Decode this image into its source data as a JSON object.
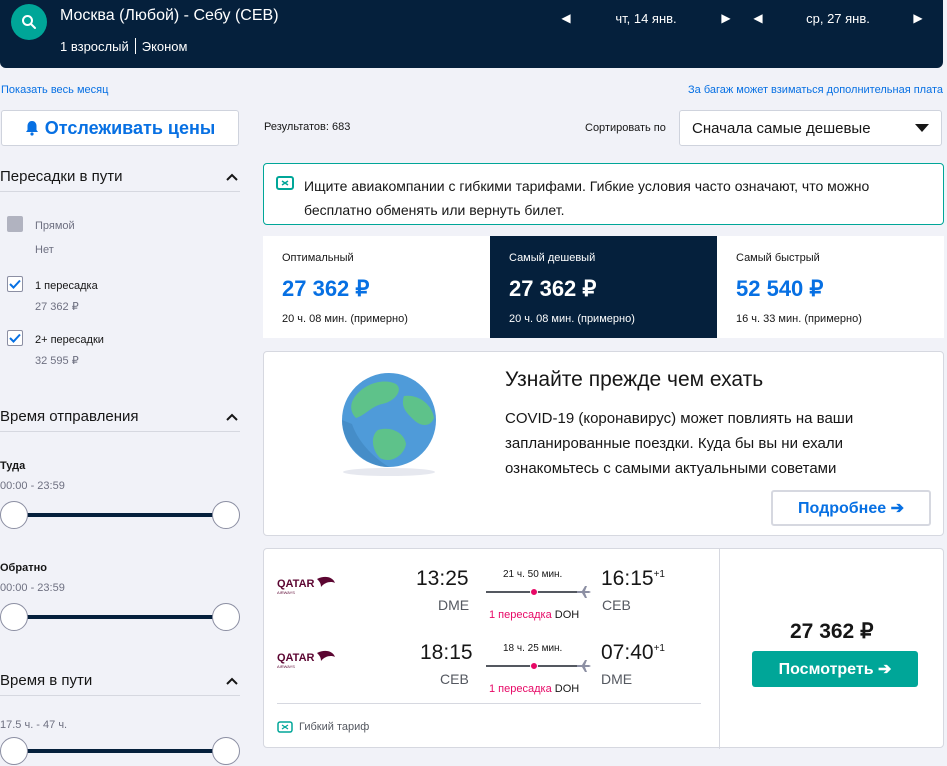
{
  "header": {
    "route": "Москва (Любой) - Себу (CEB)",
    "passengers": "1 взрослый",
    "cabin": "Эконом",
    "depart_date": "чт, 14 янв.",
    "return_date": "ср, 27 янв."
  },
  "links": {
    "show_month": "Показать весь месяц",
    "baggage": "За багаж может взиматься дополнительная плата"
  },
  "track_prices": "Отслеживать цены",
  "filters": {
    "stops": {
      "title": "Пересадки в пути",
      "options": [
        {
          "label": "Прямой",
          "price": "Нет",
          "checked": false,
          "disabled": true
        },
        {
          "label": "1 пересадка",
          "price": "27 362 ₽",
          "checked": true,
          "disabled": false
        },
        {
          "label": "2+ пересадки",
          "price": "32 595 ₽",
          "checked": true,
          "disabled": false
        }
      ]
    },
    "departure_time": {
      "title": "Время отправления",
      "outbound_label": "Туда",
      "outbound_range": "00:00 - 23:59",
      "return_label": "Обратно",
      "return_range": "00:00 - 23:59"
    },
    "journey_time": {
      "title": "Время в пути",
      "range": "17.5 ч. - 47 ч."
    }
  },
  "results": {
    "count_label": "Результатов: 683",
    "sort_label": "Сортировать по",
    "sort_value": "Сначала самые дешевые"
  },
  "info_banner": "Ищите авиакомпании с гибкими тарифами. Гибкие условия часто означают, что можно бесплатно обменять или вернуть билет.",
  "tabs": [
    {
      "label": "Оптимальный",
      "price": "27 362 ₽",
      "duration": "20 ч. 08 мин. (примерно)",
      "active": false
    },
    {
      "label": "Самый дешевый",
      "price": "27 362 ₽",
      "duration": "20 ч. 08 мин. (примерно)",
      "active": true
    },
    {
      "label": "Самый быстрый",
      "price": "52 540 ₽",
      "duration": "16 ч. 33 мин. (примерно)",
      "active": false
    }
  ],
  "covid": {
    "title": "Узнайте прежде чем ехать",
    "text": "COVID-19 (коронавирус) может повлиять на ваши запланированные поездки. Куда бы вы ни ехали ознакомьтесь с самыми актуальными советами",
    "button": "Подробнее ➔"
  },
  "flight": {
    "legs": [
      {
        "dep_time": "13:25",
        "dep_code": "DME",
        "arr_time": "16:15",
        "arr_plus": "+1",
        "arr_code": "CEB",
        "duration": "21 ч. 50 мин.",
        "stops": "1 пересадка",
        "via": "DOH"
      },
      {
        "dep_time": "18:15",
        "dep_code": "CEB",
        "arr_time": "07:40",
        "arr_plus": "+1",
        "arr_code": "DME",
        "duration": "18 ч. 25 мин.",
        "stops": "1 пересадка",
        "via": "DOH"
      }
    ],
    "airline": "QATAR",
    "price": "27 362 ₽",
    "view_button": "Посмотреть ➔",
    "flex_tag": "Гибкий тариф"
  },
  "colors": {
    "navy": "#05203c",
    "teal": "#00a698",
    "blue": "#0770e3",
    "pink": "#e70866"
  }
}
